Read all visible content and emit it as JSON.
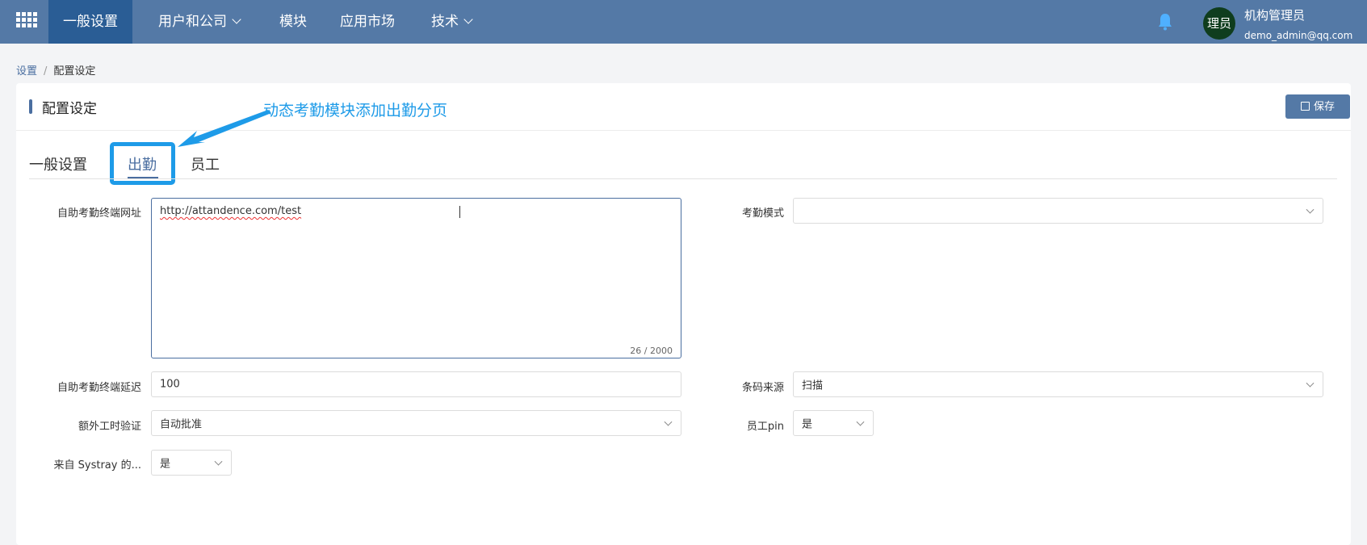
{
  "nav": {
    "items": [
      {
        "label": "一般设置",
        "active": true,
        "has_dropdown": false
      },
      {
        "label": "用户和公司",
        "active": false,
        "has_dropdown": true
      },
      {
        "label": "模块",
        "active": false,
        "has_dropdown": false
      },
      {
        "label": "应用市场",
        "active": false,
        "has_dropdown": false
      },
      {
        "label": "技术",
        "active": false,
        "has_dropdown": true
      }
    ],
    "apps_icon": "apps-grid-icon",
    "bell_icon": "bell-icon"
  },
  "user": {
    "avatar_text": "理员",
    "name": "机构管理员",
    "email": "demo_admin@qq.com"
  },
  "breadcrumb": {
    "parent": "设置",
    "separator": "/",
    "current": "配置设定"
  },
  "card": {
    "title": "配置设定",
    "save_label": "保存"
  },
  "annotation": {
    "text": "动态考勤模块添加出勤分页"
  },
  "tabs": [
    {
      "label": "一般设置",
      "active": false
    },
    {
      "label": "出勤",
      "active": true
    },
    {
      "label": "员工",
      "active": false
    }
  ],
  "form": {
    "kiosk_url": {
      "label": "自助考勤终端网址",
      "value": "http://attandence.com/test",
      "counter": "26 / 2000"
    },
    "kiosk_delay": {
      "label": "自助考勤终端延迟",
      "value": "100"
    },
    "overtime": {
      "label": "额外工时验证",
      "value": "自动批准"
    },
    "systray": {
      "label": "来自 Systray 的...",
      "value": "是"
    },
    "attendance_mode": {
      "label": "考勤模式",
      "value": ""
    },
    "barcode_source": {
      "label": "条码来源",
      "value": "扫描"
    },
    "employee_pin": {
      "label": "员工pin",
      "value": "是"
    }
  },
  "colors": {
    "topbar": "#5479a6",
    "nav_active": "#2a5d95",
    "accent": "#4a6ea0",
    "annotation": "#1e9be8",
    "avatar": "#0f3d1e"
  }
}
